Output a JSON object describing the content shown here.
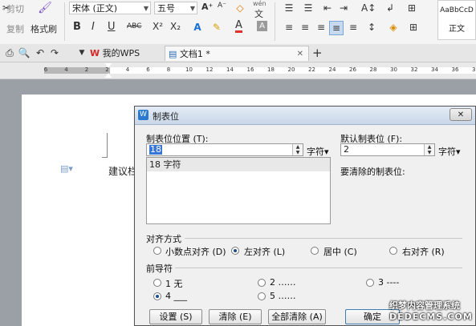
{
  "ribbon": {
    "cut": "剪切",
    "copy": "复制",
    "format_painter": "格式刷",
    "font_name": "宋体 (正文)",
    "font_size": "五号",
    "bold": "B",
    "italic": "I",
    "underline": "U",
    "strike": "ABC",
    "superscript": "X²",
    "subscript": "X₂",
    "grow_font": "A⁺",
    "shrink_font": "A⁻",
    "phonetic": "wén",
    "phonetic_char": "文",
    "font_color_letter": "A",
    "style_preview": "AaBbCcD",
    "style_name": "正文"
  },
  "tabbar": {
    "tab1_label": "我的WPS",
    "tab2_label": "文档1 *",
    "close_glyph": "✕",
    "add_glyph": "+"
  },
  "ruler": {
    "ticks": [
      "6",
      "4",
      "2",
      "2",
      "4",
      "6",
      "8",
      "10",
      "12",
      "14",
      "16",
      "18",
      "20",
      "22",
      "24",
      "26",
      "28",
      "30",
      "32",
      "34",
      "36",
      "38"
    ]
  },
  "document": {
    "body_text": "建议栏"
  },
  "dialog": {
    "title": "制表位",
    "close_glyph": "✕",
    "tab_pos_label": "制表位位置 (T):",
    "tab_pos_value": "18",
    "unit_label": "字符▾",
    "tab_list_item": "18 字符",
    "default_tab_label": "默认制表位 (F):",
    "default_tab_value": "2",
    "default_unit_label": "字符▾",
    "to_clear_label": "要清除的制表位:",
    "align_group": "对齐方式",
    "align_options": [
      "小数点对齐 (D)",
      "左对齐 (L)",
      "居中 (C)",
      "右对齐 (R)"
    ],
    "leader_group": "前导符",
    "leader_options": [
      "1 无",
      "2 ……",
      "3 ----",
      "4 ___",
      "5 ……"
    ],
    "buttons": {
      "set": "设置 (S)",
      "clear": "清除 (E)",
      "clear_all": "全部清除 (A)",
      "ok": "确定"
    }
  },
  "watermark": {
    "line1": "织梦内容管理系统",
    "line2": "DEDECMS.COM"
  }
}
